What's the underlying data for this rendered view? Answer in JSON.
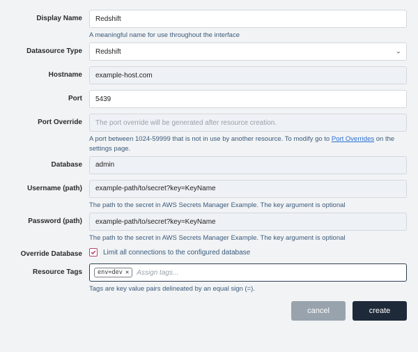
{
  "fields": {
    "display_name": {
      "label": "Display Name",
      "value": "Redshift",
      "hint": "A meaningful name for use throughout the interface"
    },
    "datasource_type": {
      "label": "Datasource Type",
      "value": "Redshift"
    },
    "hostname": {
      "label": "Hostname",
      "value": "example-host.com"
    },
    "port": {
      "label": "Port",
      "value": "5439"
    },
    "port_override": {
      "label": "Port Override",
      "placeholder": "The port override will be generated after resource creation.",
      "hint_prefix": "A port between 1024-59999 that is not in use by another resource. To modify go to ",
      "hint_link": "Port Overrides",
      "hint_suffix": " on the settings page."
    },
    "database": {
      "label": "Database",
      "value": "admin"
    },
    "username_path": {
      "label": "Username (path)",
      "value": "example-path/to/secret?key=KeyName",
      "hint": "The path to the secret in AWS Secrets Manager Example. The key argument is optional"
    },
    "password_path": {
      "label": "Password (path)",
      "value": "example-path/to/secret?key=KeyName",
      "hint": "The path to the secret in AWS Secrets Manager Example. The key argument is optional"
    },
    "override_database": {
      "label": "Override Database",
      "checked": true,
      "text": "Limit all connections to the configured database"
    },
    "resource_tags": {
      "label": "Resource Tags",
      "tags": [
        "env=dev"
      ],
      "placeholder": "Assign tags...",
      "hint": "Tags are key value pairs delineated by an equal sign (=)."
    }
  },
  "buttons": {
    "cancel": "cancel",
    "create": "create"
  },
  "colors": {
    "accent_checkbox": "#b2456e",
    "button_primary": "#1e2a3a",
    "button_secondary": "#99a3ad",
    "hint_text": "#3b5a7a"
  }
}
